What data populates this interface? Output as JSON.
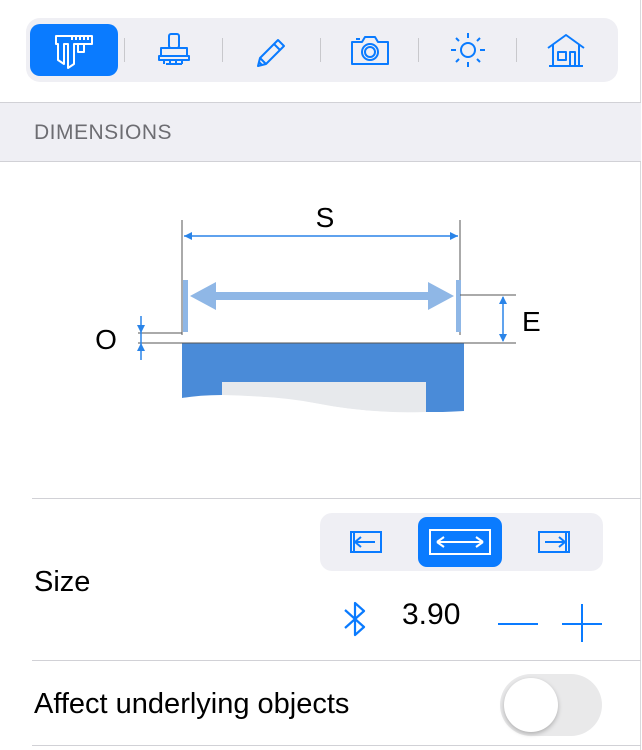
{
  "toolbar": {
    "items": [
      {
        "icon": "caliper-icon",
        "active": true
      },
      {
        "icon": "stamp-icon",
        "active": false
      },
      {
        "icon": "pencil-icon",
        "active": false
      },
      {
        "icon": "camera-icon",
        "active": false
      },
      {
        "icon": "sun-icon",
        "active": false
      },
      {
        "icon": "house-icon",
        "active": false
      }
    ]
  },
  "section": {
    "title": "DIMENSIONS"
  },
  "diagram": {
    "label_s": "S",
    "label_o": "O",
    "label_e": "E"
  },
  "size": {
    "label": "Size",
    "alignment_options": [
      "align-left-icon",
      "align-center-icon",
      "align-right-icon"
    ],
    "selected_alignment": "align-center-icon",
    "link_icon": "bluetooth-icon",
    "value": "3.90",
    "decrement_icon": "minus-icon",
    "increment_icon": "plus-icon"
  },
  "affect": {
    "label": "Affect underlying objects",
    "enabled": false
  },
  "colors": {
    "accent": "#0a7bff",
    "profile": "#4a8bd8",
    "dimension": "#2a84e8"
  }
}
